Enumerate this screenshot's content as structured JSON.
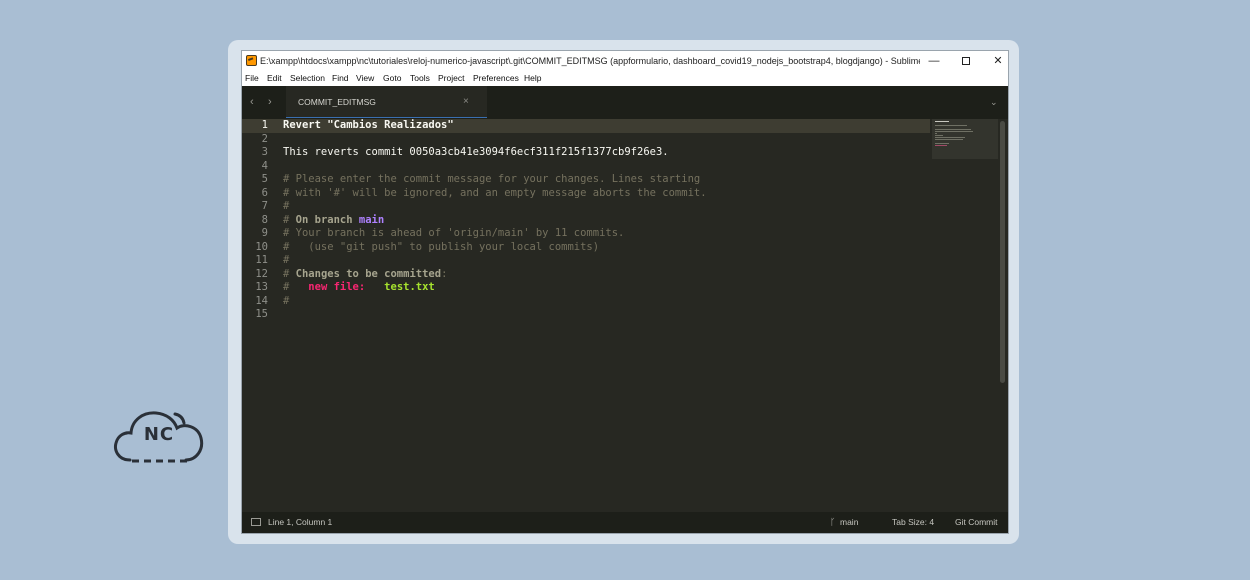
{
  "window": {
    "title": "E:\\xampp\\htdocs\\xampp\\nc\\tutoriales\\reloj-numerico-javascript\\.git\\COMMIT_EDITMSG (appformulario, dashboard_covid19_nodejs_bootstrap4, blogdjango) - Sublime Text (UNRE...",
    "minimize_glyph": "—",
    "close_glyph": "✕"
  },
  "menu": [
    "File",
    "Edit",
    "Selection",
    "Find",
    "View",
    "Goto",
    "Tools",
    "Project",
    "Preferences",
    "Help"
  ],
  "tabs": {
    "back_glyph": "‹",
    "forward_glyph": "›",
    "active_tab": "COMMIT_EDITMSG",
    "close_glyph": "×",
    "dropdown_glyph": "⌄"
  },
  "editor": {
    "line_numbers": [
      "1",
      "2",
      "3",
      "4",
      "5",
      "6",
      "7",
      "8",
      "9",
      "10",
      "11",
      "12",
      "13",
      "14",
      "15"
    ],
    "lines": {
      "l1": "Revert \"Cambios Realizados\"",
      "l3": "This reverts commit 0050a3cb41e3094f6ecf311f215f1377cb9f26e3.",
      "l5": "# Please enter the commit message for your changes. Lines starting",
      "l6": "# with '#' will be ignored, and an empty message aborts the commit.",
      "l7": "#",
      "l8_hash": "# ",
      "l8_text": "On branch ",
      "l8_branch": "main",
      "l9": "# Your branch is ahead of 'origin/main' by 11 commits.",
      "l10": "#   (use \"git push\" to publish your local commits)",
      "l11": "#",
      "l12_hash": "# ",
      "l12_text": "Changes to be committed",
      "l12_colon": ":",
      "l13_hash": "#   ",
      "l13_label": "new file:",
      "l13_gap": "   ",
      "l13_file": "test.txt",
      "l14": "#"
    }
  },
  "statusbar": {
    "position": "Line 1, Column 1",
    "branch": "main",
    "tab_size": "Tab Size: 4",
    "syntax": "Git Commit"
  },
  "logo": {
    "text": "NC"
  },
  "colors": {
    "background": "#a9bed3",
    "editor_bg": "#272822",
    "comment": "#75715e",
    "branch": "#ae81ff",
    "new_file": "#f92672",
    "file": "#a6e22e"
  }
}
